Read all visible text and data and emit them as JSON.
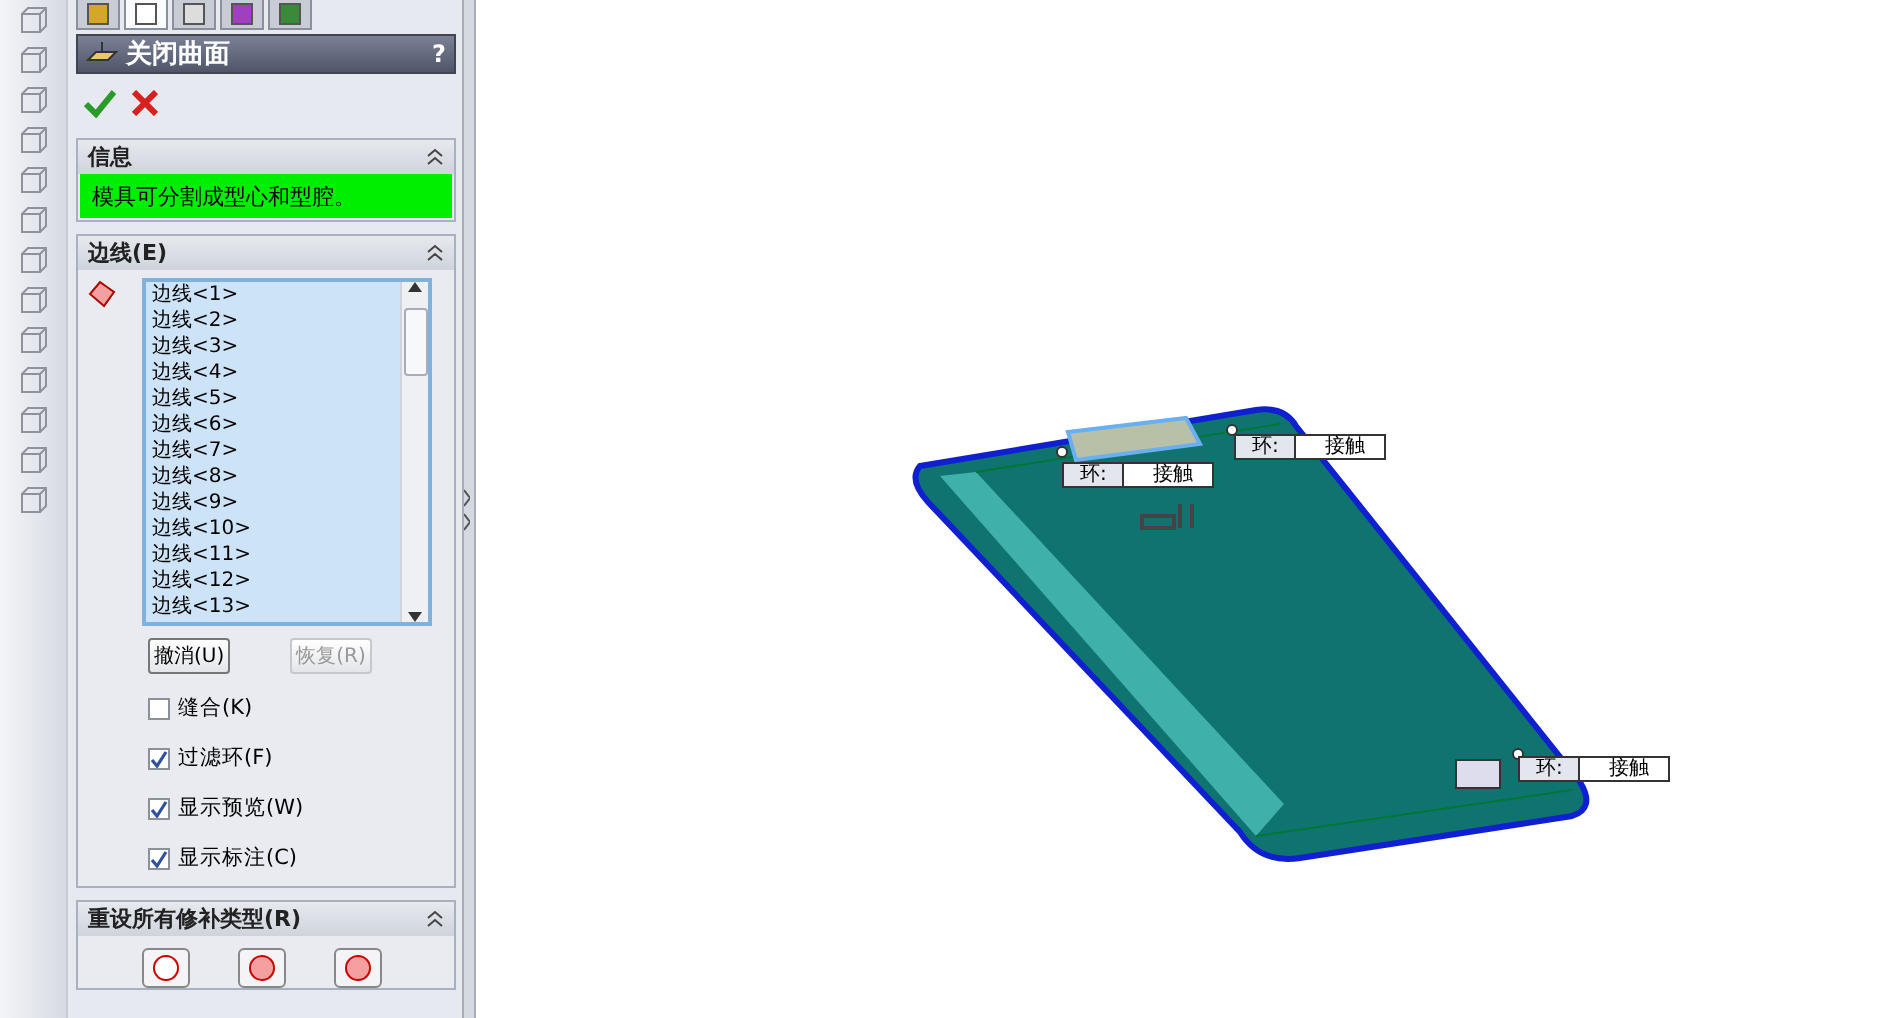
{
  "tabs": [
    {
      "kind": "feature",
      "selected": false
    },
    {
      "kind": "property",
      "selected": true
    },
    {
      "kind": "config",
      "selected": false
    },
    {
      "kind": "dimxpert",
      "selected": false
    },
    {
      "kind": "display",
      "selected": false
    }
  ],
  "panel": {
    "title": "关闭曲面",
    "help": "?"
  },
  "info": {
    "heading": "信息",
    "message": "模具可分割成型心和型腔。"
  },
  "edges": {
    "heading": "边线(E)",
    "items": [
      "边线<1>",
      "边线<2>",
      "边线<3>",
      "边线<4>",
      "边线<5>",
      "边线<6>",
      "边线<7>",
      "边线<8>",
      "边线<9>",
      "边线<10>",
      "边线<11>",
      "边线<12>",
      "边线<13>"
    ],
    "undo": {
      "label": "撤消(U)",
      "disabled": false
    },
    "redo": {
      "label": "恢复(R)",
      "disabled": true
    },
    "options": [
      {
        "label": "缝合(K)",
        "checked": false
      },
      {
        "label": "过滤环(F)",
        "checked": true
      },
      {
        "label": "显示预览(W)",
        "checked": true
      },
      {
        "label": "显示标注(C)",
        "checked": true
      }
    ]
  },
  "reset": {
    "heading": "重设所有修补类型(R)"
  },
  "callouts": [
    {
      "label": "环:",
      "value": "接触"
    },
    {
      "label": "环:",
      "value": "接触"
    },
    {
      "label": "环:",
      "value": "接触"
    }
  ]
}
